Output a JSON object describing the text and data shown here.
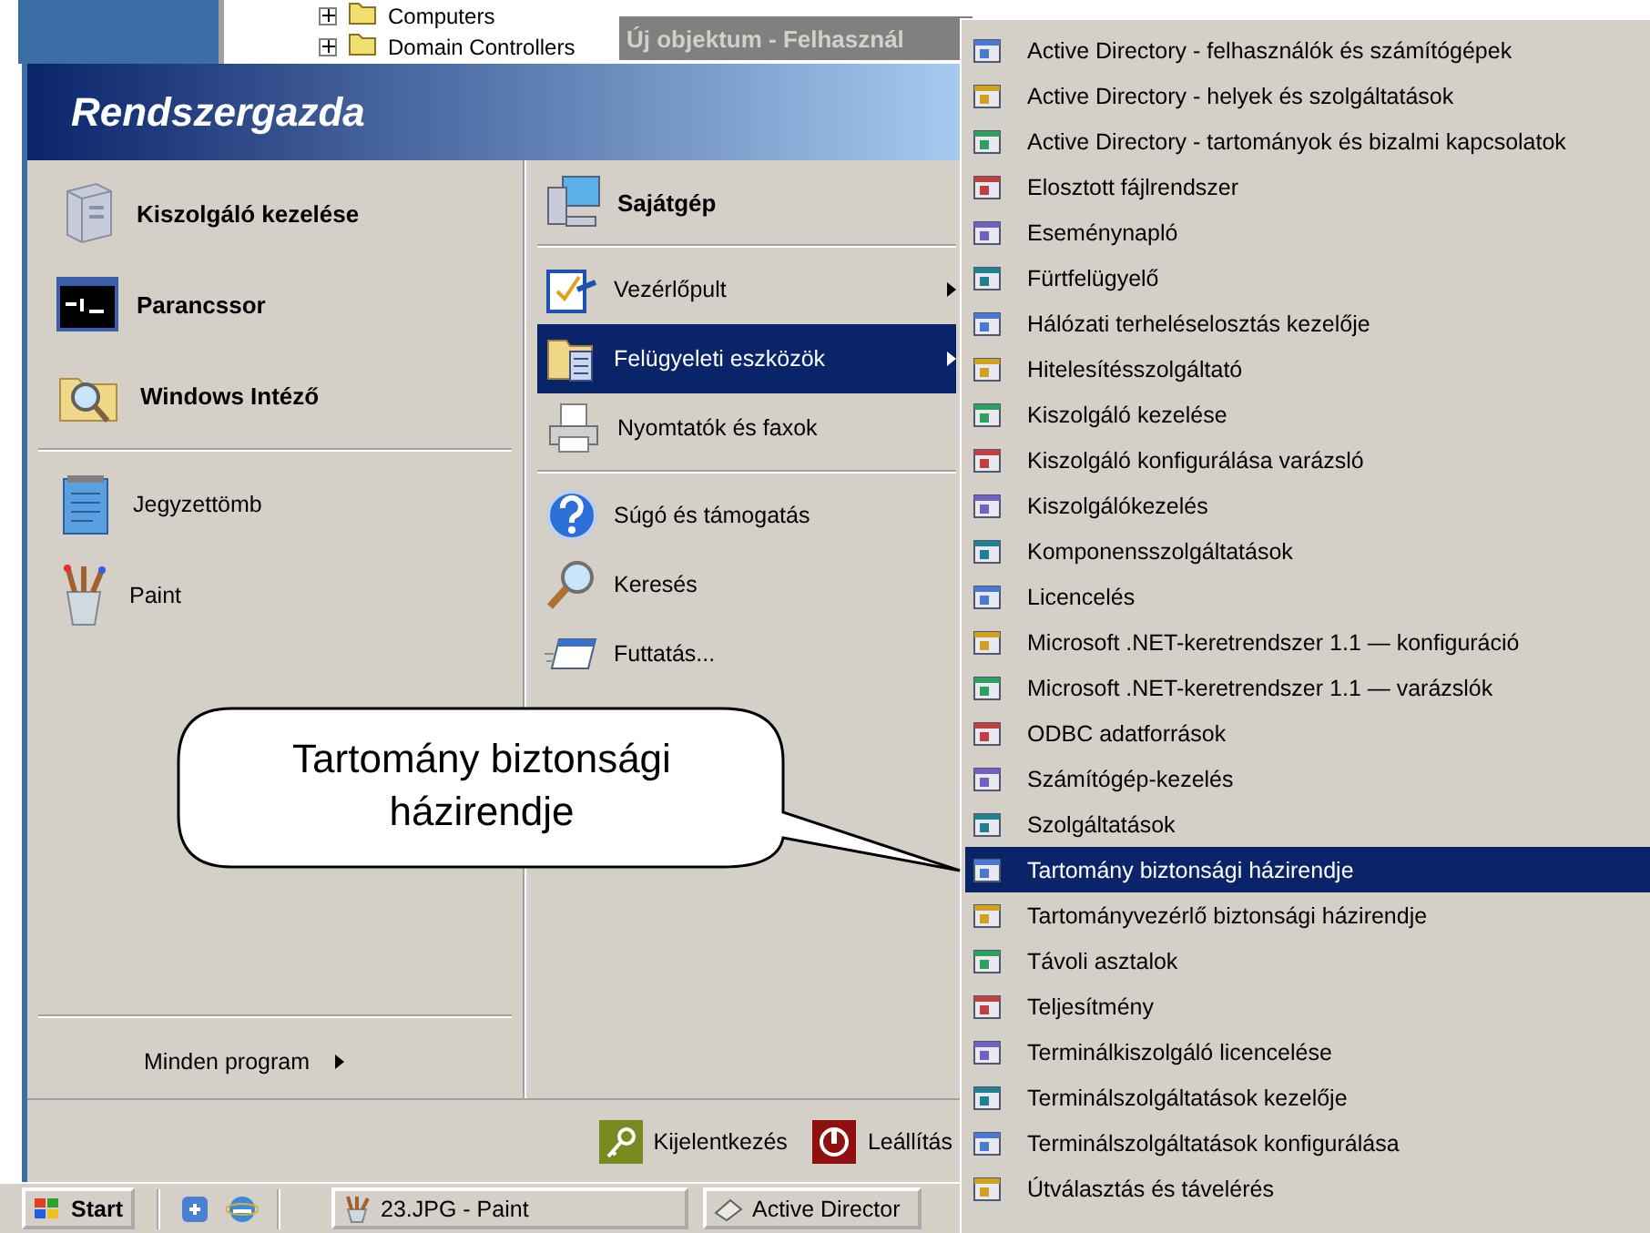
{
  "desktop": {
    "tree_items": [
      {
        "label": "Computers",
        "expanded": false
      },
      {
        "label": "Domain Controllers",
        "expanded": false
      }
    ],
    "background_window": {
      "title": "Új objektum - Felhasznál"
    }
  },
  "start_menu": {
    "user": "Rendszergazda",
    "pinned": [
      {
        "label": "Kiszolgáló kezelése"
      },
      {
        "label": "Parancssor"
      },
      {
        "label": "Windows Intéző"
      }
    ],
    "recent": [
      {
        "label": "Jegyzettömb"
      },
      {
        "label": "Paint"
      }
    ],
    "all_programs": "Minden program",
    "place_groups": [
      {
        "items": [
          {
            "label": "Sajátgép",
            "bold": true,
            "submenu": false,
            "selected": false
          }
        ]
      },
      {
        "items": [
          {
            "label": "Vezérlőpult",
            "bold": false,
            "submenu": true,
            "selected": false
          },
          {
            "label": "Felügyeleti eszközök",
            "bold": false,
            "submenu": true,
            "selected": true
          },
          {
            "label": "Nyomtatók és faxok",
            "bold": false,
            "submenu": false,
            "selected": false
          }
        ]
      },
      {
        "items": [
          {
            "label": "Súgó és támogatás",
            "bold": false,
            "submenu": false,
            "selected": false
          },
          {
            "label": "Keresés",
            "bold": false,
            "submenu": false,
            "selected": false
          },
          {
            "label": "Futtatás...",
            "bold": false,
            "submenu": false,
            "selected": false
          }
        ]
      }
    ],
    "footer": [
      {
        "label": "Kijelentkezés",
        "kind": "log_off"
      },
      {
        "label": "Leállítás",
        "kind": "shut_down"
      }
    ]
  },
  "admin_tools_menu": {
    "items": [
      {
        "label": "Active Directory - felhasználók és számítógépek",
        "selected": false
      },
      {
        "label": "Active Directory - helyek és szolgáltatások",
        "selected": false
      },
      {
        "label": "Active Directory - tartományok és bizalmi kapcsolatok",
        "selected": false
      },
      {
        "label": "Elosztott fájlrendszer",
        "selected": false
      },
      {
        "label": "Eseménynapló",
        "selected": false
      },
      {
        "label": "Fürtfelügyelő",
        "selected": false
      },
      {
        "label": "Hálózati terheléselosztás kezelője",
        "selected": false
      },
      {
        "label": "Hitelesítésszolgáltató",
        "selected": false
      },
      {
        "label": "Kiszolgáló kezelése",
        "selected": false
      },
      {
        "label": "Kiszolgáló konfigurálása varázsló",
        "selected": false
      },
      {
        "label": "Kiszolgálókezelés",
        "selected": false
      },
      {
        "label": "Komponensszolgáltatások",
        "selected": false
      },
      {
        "label": "Licencelés",
        "selected": false
      },
      {
        "label": "Microsoft .NET-keretrendszer 1.1 — konfiguráció",
        "selected": false
      },
      {
        "label": "Microsoft .NET-keretrendszer 1.1 — varázslók",
        "selected": false
      },
      {
        "label": "ODBC adatforrások",
        "selected": false
      },
      {
        "label": "Számítógép-kezelés",
        "selected": false
      },
      {
        "label": "Szolgáltatások",
        "selected": false
      },
      {
        "label": "Tartomány biztonsági házirendje",
        "selected": true
      },
      {
        "label": "Tartományvezérlő biztonsági házirendje",
        "selected": false
      },
      {
        "label": "Távoli asztalok",
        "selected": false
      },
      {
        "label": "Teljesítmény",
        "selected": false
      },
      {
        "label": "Terminálkiszolgáló licencelése",
        "selected": false
      },
      {
        "label": "Terminálszolgáltatások kezelője",
        "selected": false
      },
      {
        "label": "Terminálszolgáltatások konfigurálása",
        "selected": false
      },
      {
        "label": "Útválasztás és távelérés",
        "selected": false
      }
    ]
  },
  "callout": {
    "text": "Tartomány biztonsági házirendje"
  },
  "taskbar": {
    "start": "Start",
    "buttons": [
      {
        "label": "23.JPG - Paint",
        "kind": "paint"
      },
      {
        "label": "Active Director",
        "kind": "admin"
      }
    ]
  }
}
